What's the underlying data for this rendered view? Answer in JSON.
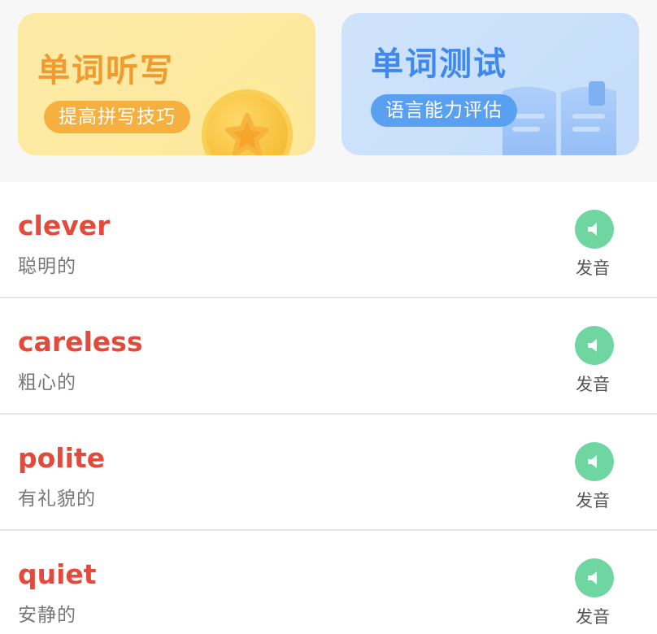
{
  "cards": {
    "dictation": {
      "title": "单词听写",
      "subtitle": "提高拼写技巧",
      "icon": "coin-star-icon"
    },
    "test": {
      "title": "单词测试",
      "subtitle": "语言能力评估",
      "icon": "book-icon"
    }
  },
  "words": [
    {
      "en": "clever",
      "cn": "聪明的",
      "speak_label": "发音"
    },
    {
      "en": "careless",
      "cn": "粗心的",
      "speak_label": "发音"
    },
    {
      "en": "polite",
      "cn": "有礼貌的",
      "speak_label": "发音"
    },
    {
      "en": "quiet",
      "cn": "安静的",
      "speak_label": "发音"
    }
  ],
  "colors": {
    "word_en": "#e34a3c",
    "speak_button": "#6fd6a2",
    "dictation_accent": "#f19a2e",
    "test_accent": "#3f88ee"
  }
}
